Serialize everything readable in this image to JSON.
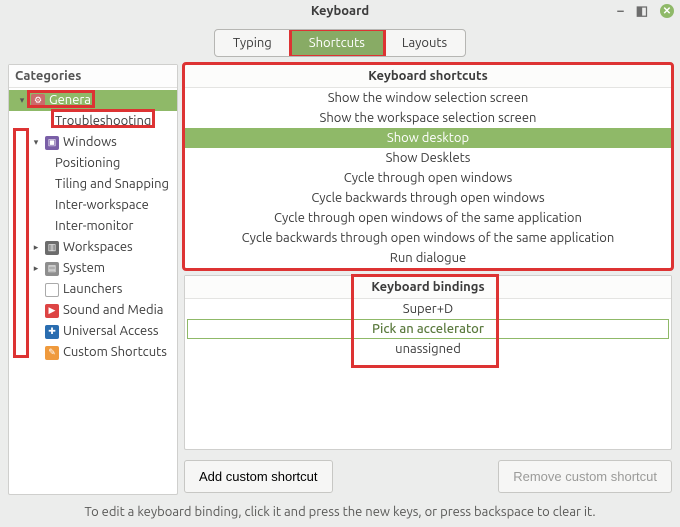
{
  "window": {
    "title": "Keyboard"
  },
  "tabs": {
    "t0": "Typing",
    "t1": "Shortcuts",
    "t2": "Layouts"
  },
  "categories_header": "Categories",
  "tree": {
    "general": "General",
    "troubleshooting": "Troubleshooting",
    "windows": "Windows",
    "positioning": "Positioning",
    "tiling": "Tiling and Snapping",
    "interws": "Inter-workspace",
    "intermon": "Inter-monitor",
    "workspaces": "Workspaces",
    "system": "System",
    "launchers": "Launchers",
    "sound": "Sound and Media",
    "ua": "Universal Access",
    "custom": "Custom Shortcuts"
  },
  "shortcuts": {
    "header": "Keyboard shortcuts",
    "items": [
      "Show the window selection screen",
      "Show the workspace selection screen",
      "Show desktop",
      "Show Desklets",
      "Cycle through open windows",
      "Cycle backwards through open windows",
      "Cycle through open windows of the same application",
      "Cycle backwards through open windows of the same application",
      "Run dialogue"
    ],
    "selected_index": 2
  },
  "bindings": {
    "header": "Keyboard bindings",
    "items": [
      "Super+D",
      "Pick an accelerator",
      "unassigned"
    ],
    "pick_index": 1
  },
  "buttons": {
    "add": "Add custom shortcut",
    "remove": "Remove custom shortcut"
  },
  "footer": "To edit a keyboard binding, click it and press the new keys, or press backspace to clear it."
}
